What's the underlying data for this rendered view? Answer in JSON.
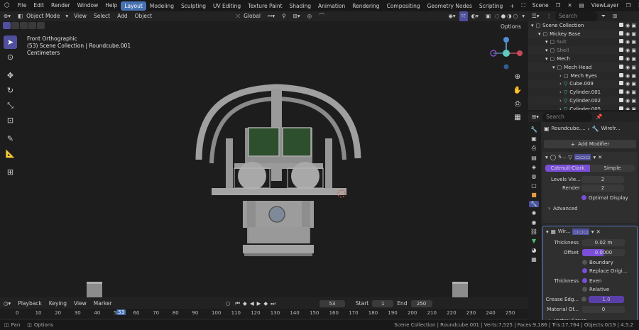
{
  "topbar": {
    "menus": [
      "File",
      "Edit",
      "Render",
      "Window",
      "Help"
    ],
    "workspaces": [
      "Layout",
      "Modeling",
      "Sculpting",
      "UV Editing",
      "Texture Paint",
      "Shading",
      "Animation",
      "Rendering",
      "Compositing",
      "Geometry Nodes",
      "Scripting"
    ],
    "active_workspace": "Layout",
    "add_tab": "+",
    "scene": "Scene",
    "view_layer": "ViewLayer"
  },
  "viewport_header": {
    "mode": "Object Mode",
    "menus": [
      "View",
      "Select",
      "Add",
      "Object"
    ],
    "transform": "Global",
    "options": "Options"
  },
  "overlay": {
    "view_name": "Front Orthographic",
    "collection": "(53) Scene Collection | Roundcube.001",
    "units": "Centimeters"
  },
  "outliner": {
    "search_placeholder": "Search",
    "rows": [
      {
        "label": "Scene Collection",
        "indent": 0
      },
      {
        "label": "Mickey Base",
        "indent": 1
      },
      {
        "label": "Suit",
        "indent": 2
      },
      {
        "label": "Shell",
        "indent": 2
      },
      {
        "label": "Mech",
        "indent": 2
      },
      {
        "label": "Mech Head",
        "indent": 3
      },
      {
        "label": "Mech Eyes",
        "indent": 4
      },
      {
        "label": "Cube.009",
        "indent": 4
      },
      {
        "label": "Cylinder.001",
        "indent": 4
      },
      {
        "label": "Cylinder.002",
        "indent": 4
      },
      {
        "label": "Cylinder.005",
        "indent": 4
      }
    ]
  },
  "properties": {
    "search_placeholder": "Search",
    "object_name": "Roundcube....",
    "modifier_tab": "Wirefr...",
    "add_modifier": "Add Modifier",
    "subsurf": {
      "name": "S...",
      "catmull": "Catmull-Clark",
      "simple": "Simple",
      "levels_label": "Levels Vie...",
      "levels_value": "2",
      "render_label": "Render",
      "render_value": "2",
      "optimal_display": "Optimal Display",
      "advanced": "Advanced"
    },
    "wireframe": {
      "name": "Wir...",
      "thickness_label": "Thickness",
      "thickness_value": "0.02 m",
      "offset_label": "Offset",
      "offset_value": "0.0000",
      "boundary": "Boundary",
      "replace_original": "Replace Origi...",
      "thickness2_label": "Thickness",
      "even": "Even",
      "relative": "Relative",
      "crease_label": "Crease Edg...",
      "crease_value": "1.0",
      "material_label": "Material Of...",
      "material_value": "0",
      "vertex_group": "Vertex Group"
    }
  },
  "timeline": {
    "menus": [
      "Playback",
      "Keying",
      "View",
      "Marker"
    ],
    "current_frame": "53",
    "start_label": "Start",
    "start_value": "1",
    "end_label": "End",
    "end_value": "250",
    "ticks": [
      "0",
      "10",
      "20",
      "30",
      "40",
      "50",
      "60",
      "70",
      "80",
      "90",
      "100",
      "110",
      "120",
      "130",
      "140",
      "150",
      "160",
      "170",
      "180",
      "190",
      "200",
      "210",
      "220",
      "230",
      "240",
      "250"
    ]
  },
  "statusbar": {
    "left1": "Pan",
    "left2": "Options",
    "info": "Scene Collection | Roundcube.001 | Verts:7,525 | Faces:9,186 | Tris:17,764 | Objects:0/19 | 4.5.2"
  },
  "colors": {
    "accent": "#4772b3",
    "active_tool": "#4f4f9e",
    "viewport_bg": "#1d1d1d",
    "model": "#9a9a9a",
    "panel": "#2b7a3a",
    "purple": "#7a4ed9"
  }
}
